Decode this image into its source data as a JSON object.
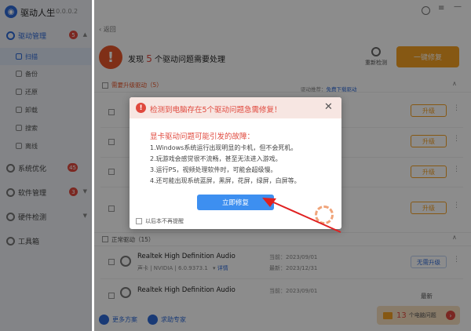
{
  "app": {
    "name": "驱动人生",
    "version": "10.0.0.2"
  },
  "sidebar": {
    "items": [
      {
        "label": "驱动管理",
        "badge": "5",
        "active": true
      },
      {
        "label": "扫描"
      },
      {
        "label": "备份"
      },
      {
        "label": "还原"
      },
      {
        "label": "卸载"
      },
      {
        "label": "搜索"
      },
      {
        "label": "离线"
      },
      {
        "label": "系统优化",
        "badge": "45"
      },
      {
        "label": "软件管理",
        "badge": "3"
      },
      {
        "label": "硬件检测"
      },
      {
        "label": "工具箱"
      }
    ]
  },
  "header": {
    "back": "返回",
    "found_prefix": "发现",
    "found_count": "5",
    "found_suffix": "个驱动问题需要处理",
    "rescan": "重新检测",
    "fix_all": "一键修复"
  },
  "sections": {
    "upgrade": "需要升级驱动（5）",
    "hint_prefix": "驱动推荐：",
    "hint_link": "免费下载驱动",
    "normal": "正常驱动（15）"
  },
  "upgrade_button": "升级",
  "normal_rows": [
    {
      "name": "Realtek High Definition Audio",
      "sub": "声卡 | NVIDIA | 6.0.9373.1",
      "link": "详情",
      "date": "当前：2023/09/01",
      "date2": "最新：2023/12/31",
      "action": "无需升级"
    },
    {
      "name": "Realtek High Definition Audio",
      "sub": "",
      "link": "",
      "date": "当前：2023/09/01",
      "date2": "",
      "action": "最新"
    }
  ],
  "footer": {
    "more": "更多方案",
    "help": "求助专家",
    "issues_count": "13",
    "issues_label": "个电脑问题"
  },
  "modal": {
    "title": "检测到电脑存在5个驱动问题急需修复！",
    "close": "✕",
    "subtitle": "显卡驱动问题可能引发的故障：",
    "lines": [
      "1.Windows系统运行出现明显的卡机，但不会死机。",
      "2.玩游戏会感觉很不流畅，甚至无法进入游戏。",
      "3.运行PS，视频处理软件时，可能会超级慢。",
      "4.还可能出现系统蓝屏，黑屏，花屏，绿屏，白屏等。"
    ],
    "button": "立即修复",
    "checkbox_label": "以后本不再提醒"
  },
  "colors": {
    "accent": "#2f6bd8",
    "warn": "#e0493e",
    "orange": "#f5a023"
  }
}
